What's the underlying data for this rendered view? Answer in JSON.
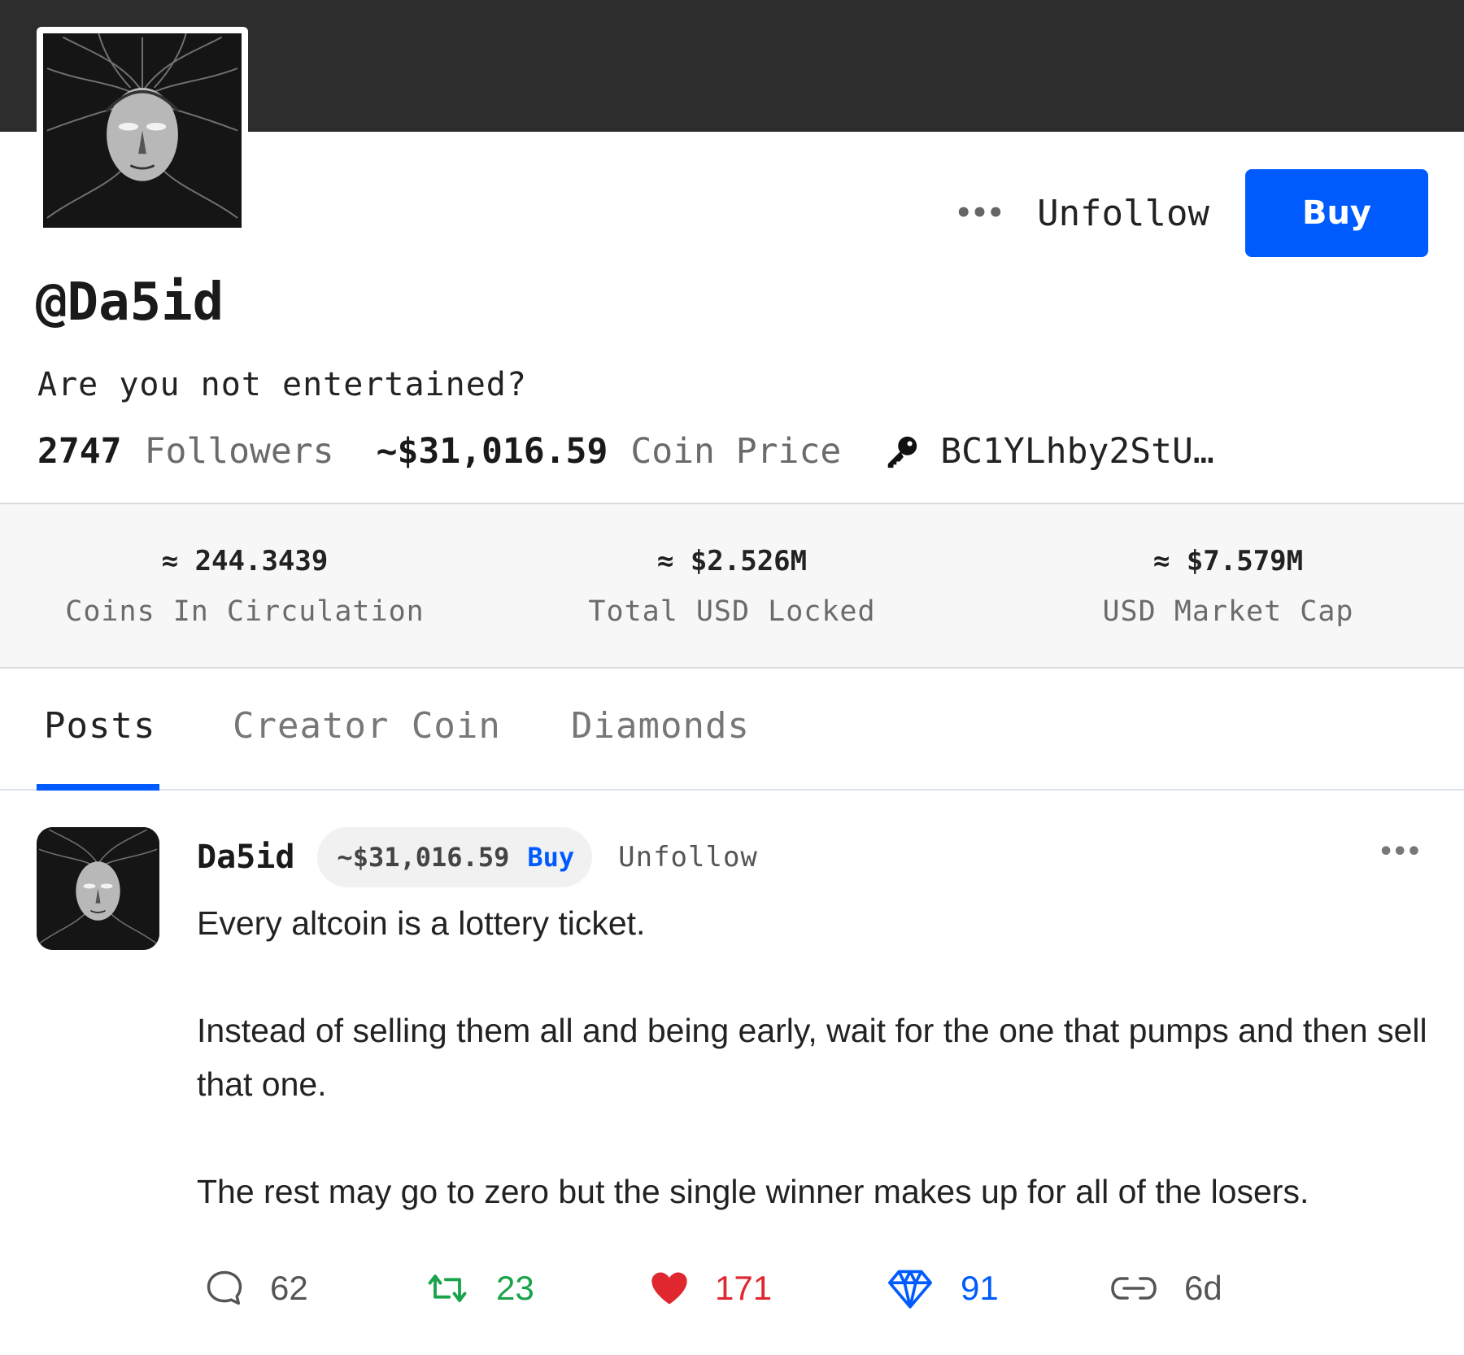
{
  "profile": {
    "username": "@Da5id",
    "bio": "Are you not entertained?",
    "followers_count": "2747",
    "followers_label": "Followers",
    "coin_price": "~$31,016.59",
    "coin_price_label": "Coin Price",
    "public_key": "BC1YLhby2StU…",
    "more_label": "•••",
    "unfollow_label": "Unfollow",
    "buy_label": "Buy"
  },
  "metrics": [
    {
      "value": "≈ 244.3439",
      "label": "Coins In Circulation"
    },
    {
      "value": "≈ $2.526M",
      "label": "Total USD Locked"
    },
    {
      "value": "≈ $7.579M",
      "label": "USD Market Cap"
    }
  ],
  "tabs": [
    {
      "label": "Posts",
      "active": true
    },
    {
      "label": "Creator Coin",
      "active": false
    },
    {
      "label": "Diamonds",
      "active": false
    }
  ],
  "post": {
    "author": "Da5id",
    "price": "~$31,016.59",
    "buy_label": "Buy",
    "unfollow_label": "Unfollow",
    "more_label": "•••",
    "paragraphs": [
      "Every altcoin is a lottery ticket.",
      "Instead of selling them all and being early, wait for the one that pumps and then sell that one.",
      "The rest may go to zero but the single winner makes up for all of the losers."
    ],
    "comments": "62",
    "reposts": "23",
    "likes": "171",
    "diamonds": "91",
    "age": "6d"
  },
  "colors": {
    "accent": "#005bff",
    "banner": "#2d2d2d",
    "repost": "#19a34a",
    "like": "#e0262f"
  },
  "icons": [
    "more-icon",
    "key-icon",
    "comment-icon",
    "repost-icon",
    "heart-icon",
    "diamond-icon",
    "link-icon"
  ]
}
